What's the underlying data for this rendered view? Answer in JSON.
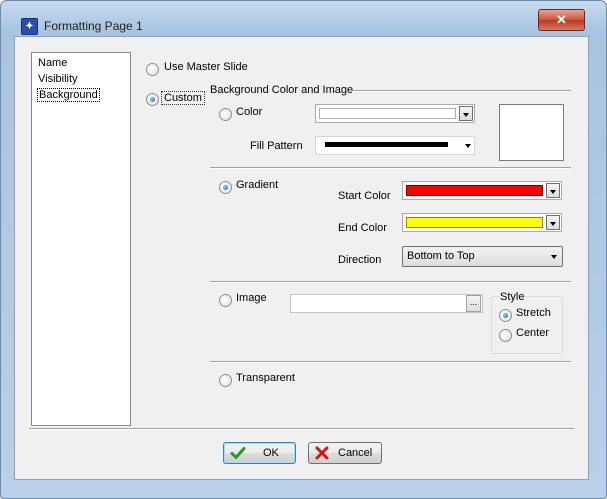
{
  "window": {
    "title": "Formatting Page 1",
    "close_glyph": "✕"
  },
  "nav": {
    "items": [
      "Name",
      "Visibility",
      "Background"
    ],
    "selected": "Background"
  },
  "options": {
    "use_master": "Use Master Slide",
    "custom": "Custom"
  },
  "group_title": "Background Color and Image",
  "color_section": {
    "color_label": "Color",
    "color_value": "#ffffff",
    "fill_pattern_label": "Fill Pattern",
    "fill_pattern_value": "#000000"
  },
  "gradient_section": {
    "label": "Gradient",
    "start_color_label": "Start Color",
    "start_color": "#ff0000",
    "end_color_label": "End Color",
    "end_color": "#ffff00",
    "direction_label": "Direction",
    "direction_value": "Bottom to Top"
  },
  "image_section": {
    "label": "Image",
    "path_value": "",
    "browse_label": "...",
    "style_title": "Style",
    "stretch": "Stretch",
    "center": "Center"
  },
  "transparent_label": "Transparent",
  "buttons": {
    "ok": "OK",
    "cancel": "Cancel"
  },
  "icons": {
    "app": "formatting-app-icon",
    "ok": "green-check-icon",
    "cancel": "red-x-icon"
  },
  "colors": {
    "ok_check": "#1e9e22",
    "cancel_x": "#d41515"
  }
}
